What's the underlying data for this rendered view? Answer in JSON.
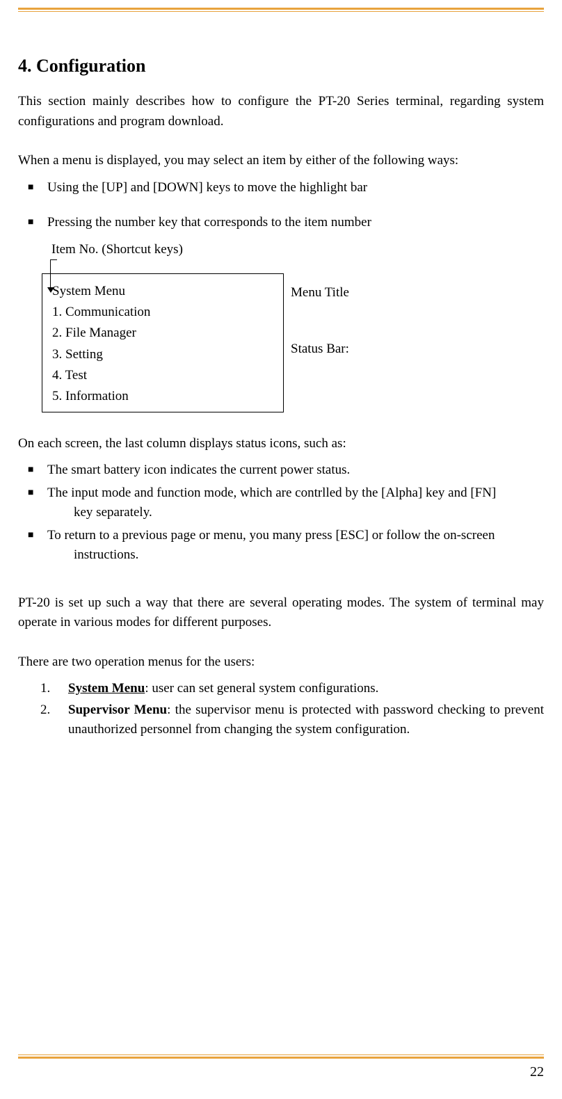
{
  "heading": "4.   Configuration",
  "para1": "This section mainly describes how to configure the PT-20 Series terminal, regarding system configurations and program download.",
  "para2": "When a menu is displayed, you may select an item by either of the following ways:",
  "bullets1": [
    "Using the [UP] and [DOWN] keys to move the highlight bar",
    "Pressing the number key that corresponds to the item number"
  ],
  "diagram": {
    "itemNoLabel": "Item No. (Shortcut keys)",
    "menu": {
      "title": "System Menu",
      "items": [
        "1. Communication",
        "2. File Manager",
        "3. Setting",
        "4. Test",
        "5. Information"
      ]
    },
    "menuTitleLabel": "Menu Title",
    "statusBarLabel": "Status Bar:"
  },
  "para3": "On each screen, the last column displays status icons, such as:",
  "bullets2": [
    {
      "line1": "The smart battery icon indicates the current power status."
    },
    {
      "line1": "The input mode and function mode, which are contrlled by the [Alpha] key and [FN]",
      "line2": "key separately."
    },
    {
      "line1": "To return to a previous page or menu, you many press [ESC] or follow the on-screen",
      "line2": "instructions."
    }
  ],
  "para4": "PT-20 is set up such a way that there are several operating modes. The system of terminal may operate in various modes for different purposes.",
  "para5": "There are two operation menus for the users:",
  "numlist": [
    {
      "num": "1.",
      "bold": "System Menu",
      "text": ": user can set general system configurations."
    },
    {
      "num": "2.",
      "bold": "Supervisor Menu",
      "text": ": the supervisor menu is protected with password checking to prevent unauthorized personnel from changing the system configuration."
    }
  ],
  "pageNumber": "22"
}
